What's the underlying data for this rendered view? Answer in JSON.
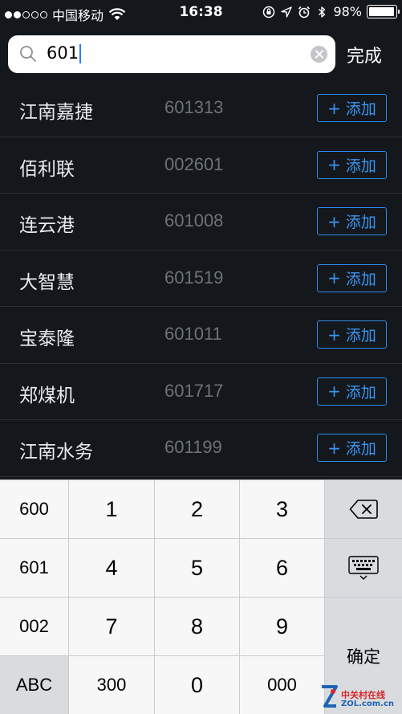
{
  "status_bar": {
    "carrier": "中国移动",
    "time": "16:38",
    "battery": "98%",
    "signal_bars_filled": 2,
    "signal_bars_total": 5,
    "icons": [
      "wifi-icon",
      "orientation-lock-icon",
      "location-icon",
      "alarm-icon",
      "bluetooth-icon",
      "battery-icon"
    ]
  },
  "search": {
    "value": "601",
    "icon": "search-icon",
    "clear_icon": "clear-icon",
    "done_label": "完成"
  },
  "results": [
    {
      "name": "江南嘉捷",
      "code": "601313",
      "add_label": "添加"
    },
    {
      "name": "佰利联",
      "code": "002601",
      "add_label": "添加"
    },
    {
      "name": "连云港",
      "code": "601008",
      "add_label": "添加"
    },
    {
      "name": "大智慧",
      "code": "601519",
      "add_label": "添加"
    },
    {
      "name": "宝泰隆",
      "code": "601011",
      "add_label": "添加"
    },
    {
      "name": "郑煤机",
      "code": "601717",
      "add_label": "添加"
    },
    {
      "name": "江南水务",
      "code": "601199",
      "add_label": "添加"
    }
  ],
  "add_plus": "+",
  "keyboard": {
    "prefix_keys": [
      "600",
      "601",
      "002",
      "ABC"
    ],
    "digits": [
      "1",
      "2",
      "3",
      "4",
      "5",
      "6",
      "7",
      "8",
      "9"
    ],
    "bottom": [
      "300",
      "0",
      "000"
    ],
    "confirm_label": "确定",
    "backspace_icon": "backspace-icon",
    "hide_keyboard_icon": "keyboard-icon"
  },
  "watermark": {
    "top": "中关村在线",
    "bottom": "ZOL.com.cn"
  },
  "colors": {
    "background": "#14171c",
    "accent": "#2d8cf0",
    "code_text": "#6d7278",
    "keyboard_bg": "#c8ccd1"
  }
}
